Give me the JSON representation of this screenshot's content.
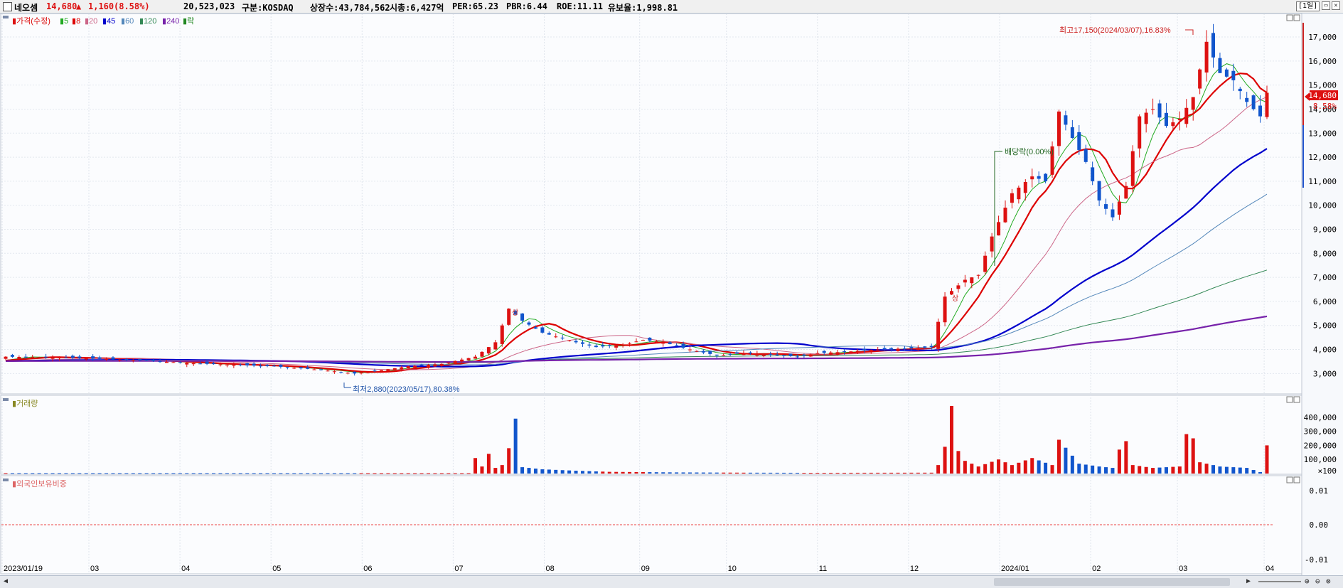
{
  "header": {
    "name": "네오셈",
    "price": "14,680",
    "change_arrow": "▲",
    "change": "1,160",
    "change_pct": "(8.58%)",
    "volume": "20,523,023",
    "market": "구분:KOSDAQ",
    "shares": "상장수:43,784,562",
    "mcap": "시총:6,427억",
    "per": "PER:65.23",
    "pbr": "PBR:6.44",
    "roe": "ROE:11.11",
    "turnover": "유보율:1,998.81",
    "period": "[1일]"
  },
  "legend": {
    "price_label": "가격(수정)",
    "ma": [
      {
        "label": "5",
        "color": "#22aa22"
      },
      {
        "label": "8",
        "color": "#dd0000"
      },
      {
        "label": "20",
        "color": "#cc6688"
      },
      {
        "label": "45",
        "color": "#0000cc"
      },
      {
        "label": "60",
        "color": "#5588bb"
      },
      {
        "label": "120",
        "color": "#338855"
      },
      {
        "label": "240",
        "color": "#7722aa"
      }
    ],
    "drop_label": "락",
    "volume_label": "거래량",
    "foreign_label": "외국인보유비중"
  },
  "annotations": {
    "high": "최고17,150(2024/03/07),16.83%",
    "low": "최저2,880(2023/05/17),80.38%",
    "dividend": "배당락(0.00%)",
    "rise1": "상",
    "rise2": "상"
  },
  "price_tag": {
    "value": "14,680",
    "pct": "8.58%"
  },
  "colors": {
    "up": "#dd1111",
    "down": "#1155cc",
    "ma5": "#22aa22",
    "ma8": "#dd0000",
    "ma20": "#cc6688",
    "ma45": "#0000cc",
    "ma60": "#5588bb",
    "ma120": "#338855",
    "ma240": "#7722aa"
  },
  "chart_data": {
    "type": "candlestick",
    "x_ticks": [
      "2023/01/19",
      "03",
      "04",
      "05",
      "06",
      "07",
      "08",
      "09",
      "10",
      "11",
      "12",
      "2024/01",
      "02",
      "03",
      "04"
    ],
    "y_ticks": [
      "3,000",
      "4,000",
      "5,000",
      "6,000",
      "7,000",
      "8,000",
      "9,000",
      "10,000",
      "11,000",
      "12,000",
      "13,000",
      "14,000",
      "15,000",
      "16,000",
      "17,000"
    ],
    "ylim": [
      2300,
      17800
    ],
    "volume_ticks": [
      "400,000",
      "300,000",
      "200,000",
      "100,000"
    ],
    "volume_unit": "×100",
    "volume_ylim": [
      0,
      500000
    ],
    "foreign_ticks": [
      "0.01",
      "0.00",
      "-0.01"
    ],
    "close_keypoints": [
      [
        0,
        3700
      ],
      [
        10,
        3650
      ],
      [
        20,
        3550
      ],
      [
        30,
        3400
      ],
      [
        40,
        3300
      ],
      [
        47,
        3150
      ],
      [
        52,
        3000
      ],
      [
        55,
        3100
      ],
      [
        60,
        3300
      ],
      [
        65,
        3400
      ],
      [
        70,
        3700
      ],
      [
        73,
        4300
      ],
      [
        75,
        5700
      ],
      [
        77,
        5200
      ],
      [
        80,
        4700
      ],
      [
        85,
        4300
      ],
      [
        88,
        4100
      ],
      [
        92,
        4200
      ],
      [
        95,
        4400
      ],
      [
        98,
        4300
      ],
      [
        102,
        4000
      ],
      [
        106,
        3750
      ],
      [
        110,
        3850
      ],
      [
        114,
        3800
      ],
      [
        118,
        3700
      ],
      [
        121,
        3850
      ],
      [
        125,
        3900
      ],
      [
        130,
        4000
      ],
      [
        135,
        4050
      ],
      [
        138,
        4100
      ],
      [
        140,
        6200
      ],
      [
        143,
        6900
      ],
      [
        145,
        7100
      ],
      [
        147,
        8700
      ],
      [
        150,
        10500
      ],
      [
        153,
        11200
      ],
      [
        155,
        11000
      ],
      [
        157,
        13900
      ],
      [
        159,
        12800
      ],
      [
        161,
        11800
      ],
      [
        163,
        10200
      ],
      [
        165,
        9500
      ],
      [
        167,
        10800
      ],
      [
        169,
        13700
      ],
      [
        171,
        14000
      ],
      [
        173,
        13300
      ],
      [
        175,
        13600
      ],
      [
        177,
        14500
      ],
      [
        179,
        16800
      ],
      [
        181,
        15500
      ],
      [
        183,
        15200
      ],
      [
        185,
        14300
      ],
      [
        187,
        13700
      ],
      [
        188,
        14680
      ]
    ],
    "volume_keypoints": [
      [
        0,
        2000
      ],
      [
        69,
        2000
      ],
      [
        70,
        110000
      ],
      [
        71,
        50000
      ],
      [
        72,
        140000
      ],
      [
        73,
        40000
      ],
      [
        74,
        60000
      ],
      [
        75,
        180000
      ],
      [
        76,
        390000
      ],
      [
        77,
        45000
      ],
      [
        80,
        30000
      ],
      [
        85,
        20000
      ],
      [
        90,
        12000
      ],
      [
        100,
        8000
      ],
      [
        110,
        6000
      ],
      [
        120,
        5000
      ],
      [
        138,
        6000
      ],
      [
        139,
        60000
      ],
      [
        140,
        190000
      ],
      [
        141,
        480000
      ],
      [
        142,
        160000
      ],
      [
        143,
        90000
      ],
      [
        145,
        50000
      ],
      [
        148,
        100000
      ],
      [
        150,
        60000
      ],
      [
        153,
        110000
      ],
      [
        156,
        60000
      ],
      [
        157,
        240000
      ],
      [
        160,
        70000
      ],
      [
        163,
        50000
      ],
      [
        165,
        40000
      ],
      [
        166,
        170000
      ],
      [
        167,
        230000
      ],
      [
        168,
        60000
      ],
      [
        171,
        40000
      ],
      [
        175,
        50000
      ],
      [
        176,
        280000
      ],
      [
        177,
        250000
      ],
      [
        178,
        80000
      ],
      [
        181,
        50000
      ],
      [
        185,
        40000
      ],
      [
        187,
        10000
      ],
      [
        188,
        200000
      ]
    ],
    "num_bars": 189,
    "ma_lengths": [
      5,
      8,
      20,
      45,
      60,
      120,
      240
    ]
  }
}
